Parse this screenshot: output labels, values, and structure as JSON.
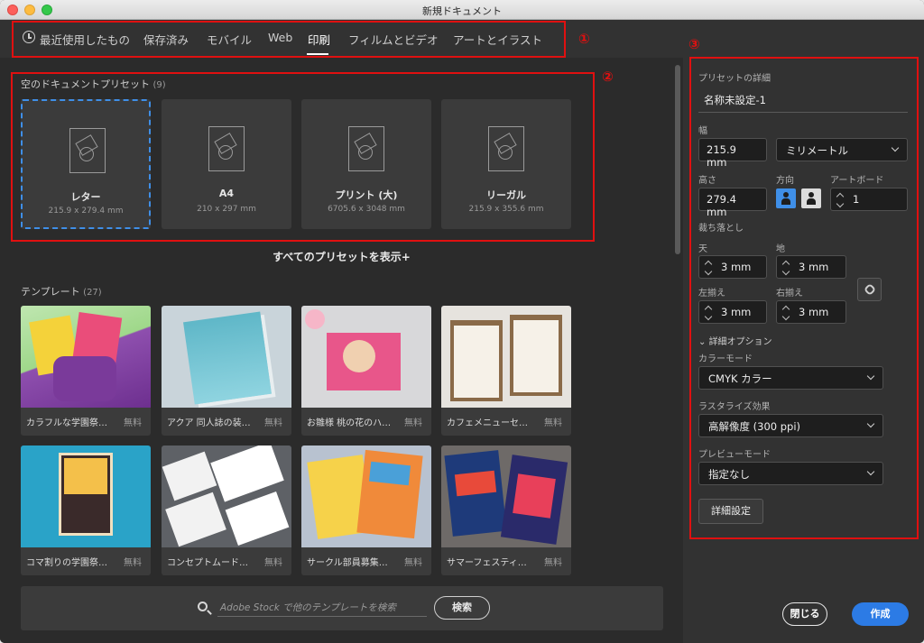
{
  "window": {
    "title": "新規ドキュメント"
  },
  "tabs": [
    {
      "label": "最近使用したもの"
    },
    {
      "label": "保存済み"
    },
    {
      "label": "モバイル"
    },
    {
      "label": "Web"
    },
    {
      "label": "印刷",
      "active": true
    },
    {
      "label": "フィルムとビデオ"
    },
    {
      "label": "アートとイラスト"
    }
  ],
  "annotations": {
    "m1": "①",
    "m2": "②",
    "m3": "③"
  },
  "presets": {
    "title": "空のドキュメントプリセット",
    "count": "(9)",
    "items": [
      {
        "name": "レター",
        "dims": "215.9 x 279.4 mm",
        "selected": true
      },
      {
        "name": "A4",
        "dims": "210 x 297 mm"
      },
      {
        "name": "プリント (大)",
        "dims": "6705.6 x 3048 mm"
      },
      {
        "name": "リーガル",
        "dims": "215.9 x 355.6 mm"
      }
    ],
    "show_all": "すべてのプリセットを表示+"
  },
  "templates": {
    "title": "テンプレート",
    "count": "(27)",
    "items": [
      {
        "name": "カラフルな学園祭…",
        "price": "無料"
      },
      {
        "name": "アクア 同人誌の装…",
        "price": "無料"
      },
      {
        "name": "お雛様 桃の花のハ…",
        "price": "無料"
      },
      {
        "name": "カフェメニューセ…",
        "price": "無料"
      },
      {
        "name": "コマ割りの学園祭…",
        "price": "無料"
      },
      {
        "name": "コンセプトムード…",
        "price": "無料"
      },
      {
        "name": "サークル部員募集…",
        "price": "無料"
      },
      {
        "name": "サマーフェスティ…",
        "price": "無料"
      }
    ]
  },
  "search": {
    "placeholder": "Adobe Stock で他のテンプレートを検索",
    "button": "検索"
  },
  "details": {
    "title": "プリセットの詳細",
    "name": "名称未設定-1",
    "width_label": "幅",
    "width": "215.9 mm",
    "unit": "ミリメートル",
    "height_label": "高さ",
    "height": "279.4 mm",
    "orientation_label": "方向",
    "artboard_label": "アートボード",
    "artboard": "1",
    "bleed_label": "裁ち落とし",
    "top_label": "天",
    "top": "3 mm",
    "bottom_label": "地",
    "bottom": "3 mm",
    "left_label": "左揃え",
    "left": "3 mm",
    "right_label": "右揃え",
    "right": "3 mm",
    "advanced_toggle": "詳細オプション",
    "color_mode_label": "カラーモード",
    "color_mode": "CMYK カラー",
    "raster_label": "ラスタライズ効果",
    "raster": "高解像度 (300 ppi)",
    "preview_label": "プレビューモード",
    "preview": "指定なし",
    "advanced_button": "詳細設定"
  },
  "footer": {
    "close": "閉じる",
    "create": "作成"
  }
}
